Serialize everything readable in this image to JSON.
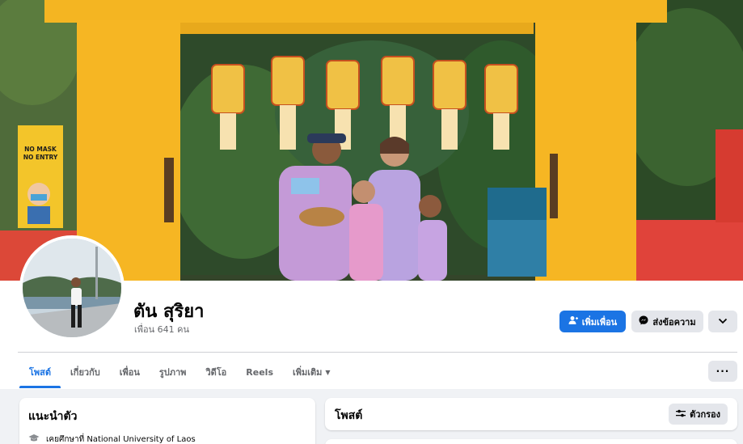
{
  "profile": {
    "name": "ตัน สุริยา",
    "friends_count": "เพื่อน 641 คน"
  },
  "cover": {
    "sign_line1": "NO MASK",
    "sign_line2": "NO ENTRY"
  },
  "actions": {
    "add_friend_label": "เพิ่มเพื่อน",
    "message_label": "ส่งข้อความ",
    "more_label": "⌄"
  },
  "tabs": [
    {
      "label": "โพสต์",
      "active": true
    },
    {
      "label": "เกี่ยวกับ",
      "active": false
    },
    {
      "label": "เพื่อน",
      "active": false
    },
    {
      "label": "รูปภาพ",
      "active": false
    },
    {
      "label": "วิดีโอ",
      "active": false
    },
    {
      "label": "Reels",
      "active": false
    },
    {
      "label": "เพิ่มเติม",
      "active": false
    }
  ],
  "tab_more_caret": "▼",
  "tab_dots_label": "···",
  "intro": {
    "title": "แนะนำตัว",
    "education": "เคยศึกษาที่ National University of Laos"
  },
  "posts": {
    "title": "โพสต์",
    "filter_label": "ตัวกรอง"
  },
  "colors": {
    "accent": "#1b74e4",
    "page_bg": "#f0f2f5",
    "button_gray": "#e4e6eb",
    "text_secondary": "#65676b"
  },
  "icons": {
    "add_friend": "person-plus-icon",
    "message": "messenger-icon",
    "more": "chevron-down-icon",
    "education": "graduation-cap-icon",
    "filter": "sliders-icon"
  }
}
